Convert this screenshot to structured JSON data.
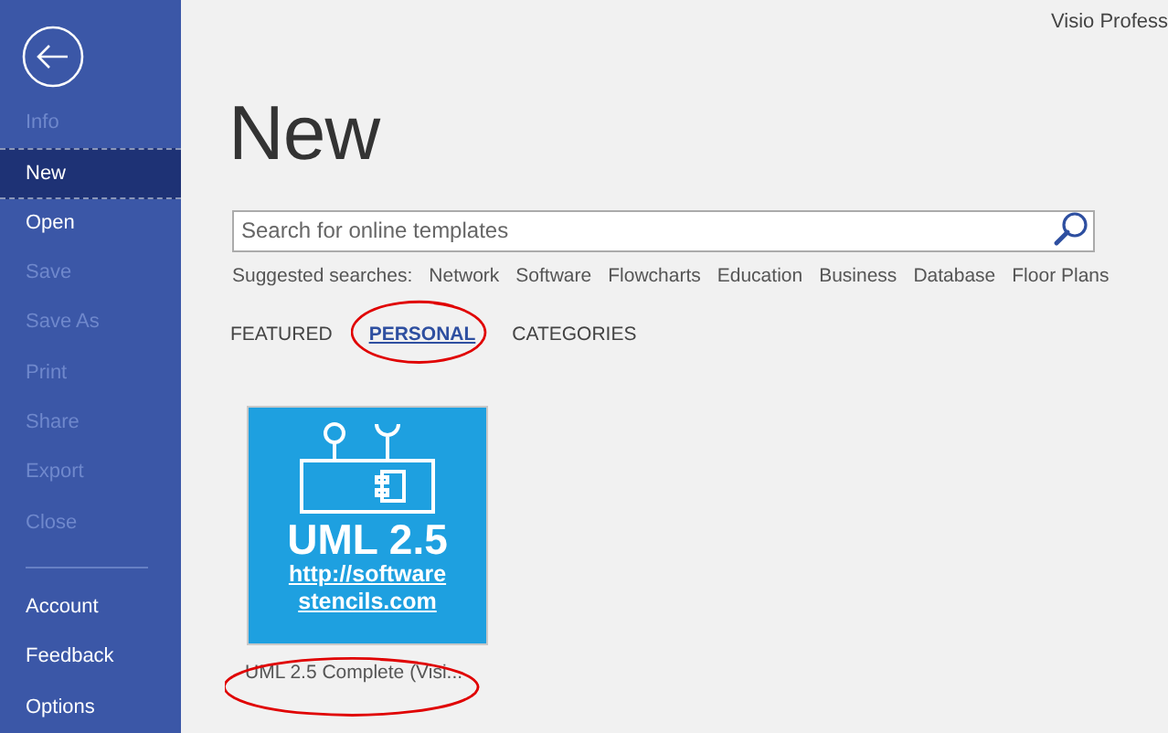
{
  "sidebar": {
    "items": [
      {
        "label": "Info",
        "disabled": true,
        "selected": false
      },
      {
        "label": "New",
        "disabled": false,
        "selected": true
      },
      {
        "label": "Open",
        "disabled": false,
        "selected": false
      },
      {
        "label": "Save",
        "disabled": true,
        "selected": false
      },
      {
        "label": "Save As",
        "disabled": true,
        "selected": false
      },
      {
        "label": "Print",
        "disabled": true,
        "selected": false
      },
      {
        "label": "Share",
        "disabled": true,
        "selected": false
      },
      {
        "label": "Export",
        "disabled": true,
        "selected": false
      },
      {
        "label": "Close",
        "disabled": true,
        "selected": false
      }
    ],
    "footer_items": [
      {
        "label": "Account",
        "disabled": false,
        "selected": false
      },
      {
        "label": "Feedback",
        "disabled": false,
        "selected": false
      },
      {
        "label": "Options",
        "disabled": false,
        "selected": false
      }
    ]
  },
  "app_title": "Visio Profess",
  "page_title": "New",
  "search": {
    "placeholder": "Search for online templates"
  },
  "suggested": {
    "label": "Suggested searches:",
    "items": [
      "Network",
      "Software",
      "Flowcharts",
      "Education",
      "Business",
      "Database",
      "Floor Plans"
    ]
  },
  "tabs": [
    {
      "label": "FEATURED",
      "selected": false,
      "circled": false
    },
    {
      "label": "PERSONAL",
      "selected": true,
      "circled": true
    },
    {
      "label": "CATEGORIES",
      "selected": false,
      "circled": false
    }
  ],
  "templates": [
    {
      "thumbnail_title": "UML 2.5",
      "thumbnail_link": [
        "http://software",
        "stencils.com"
      ],
      "caption": "UML 2.5 Complete (Visi...",
      "circled": true
    }
  ]
}
